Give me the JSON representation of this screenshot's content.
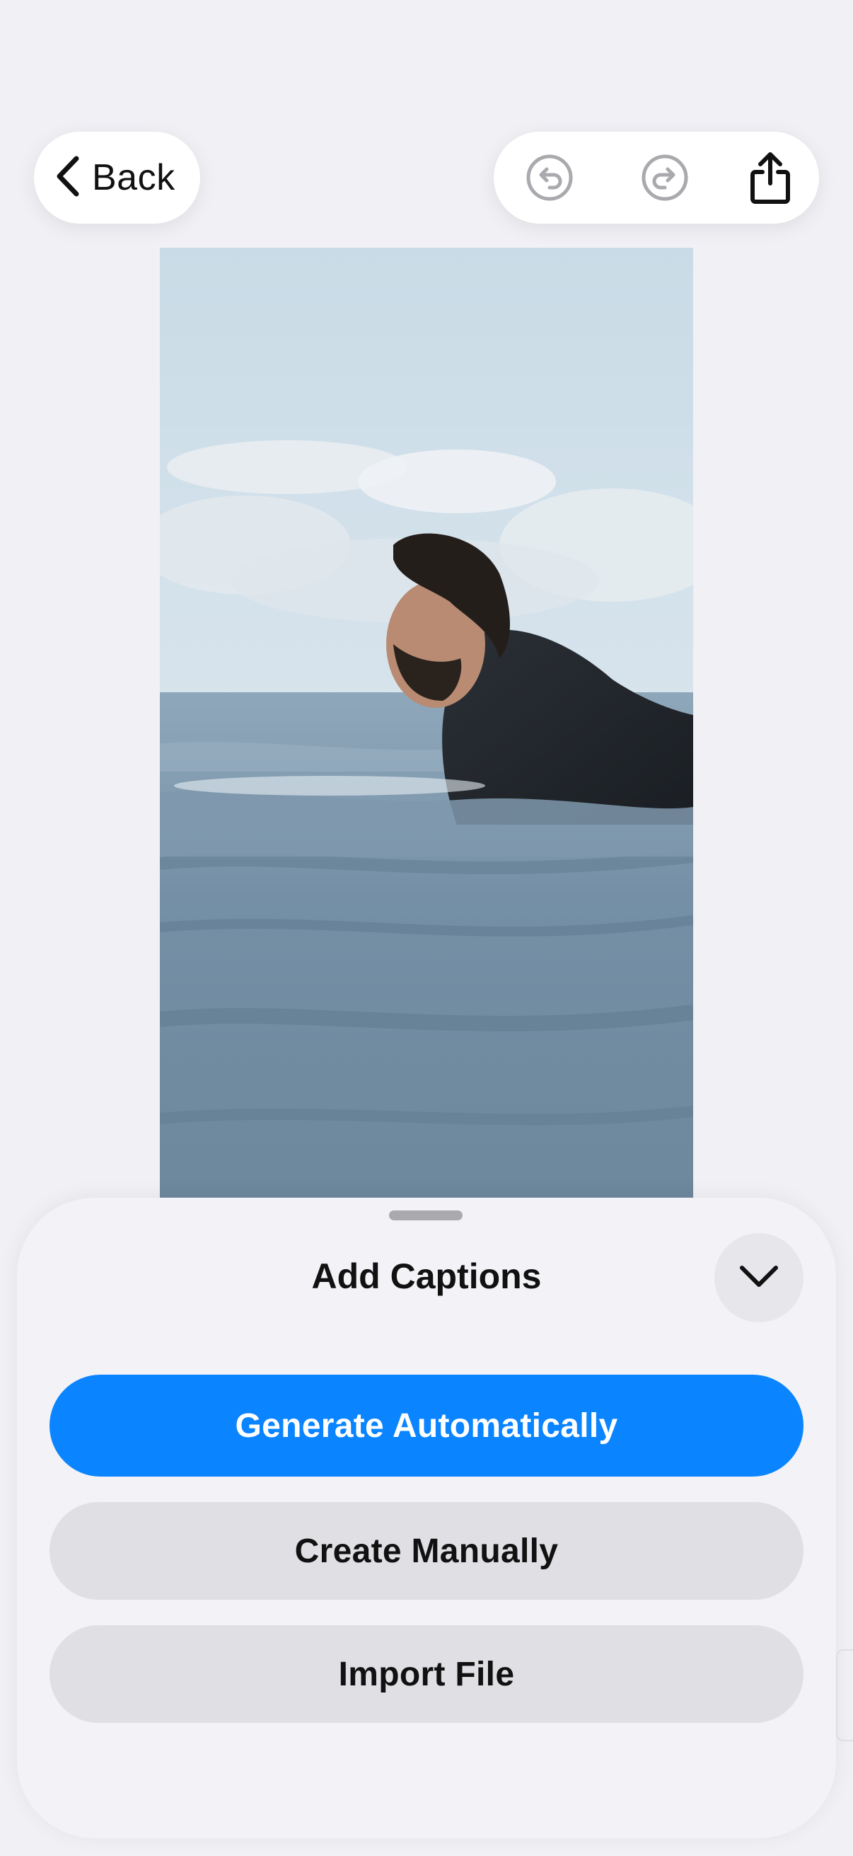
{
  "toolbar": {
    "back_label": "Back",
    "undo_icon": "undo-icon",
    "redo_icon": "redo-icon",
    "share_icon": "share-icon"
  },
  "preview": {
    "subject": "video-frame"
  },
  "sheet": {
    "title": "Add Captions",
    "collapse_icon": "chevron-down-icon",
    "generate_label": "Generate Automatically",
    "create_label": "Create Manually",
    "import_label": "Import File"
  },
  "colors": {
    "accent": "#0a84ff",
    "background": "#f0f0f5",
    "secondary_button": "#dfdfe4"
  }
}
